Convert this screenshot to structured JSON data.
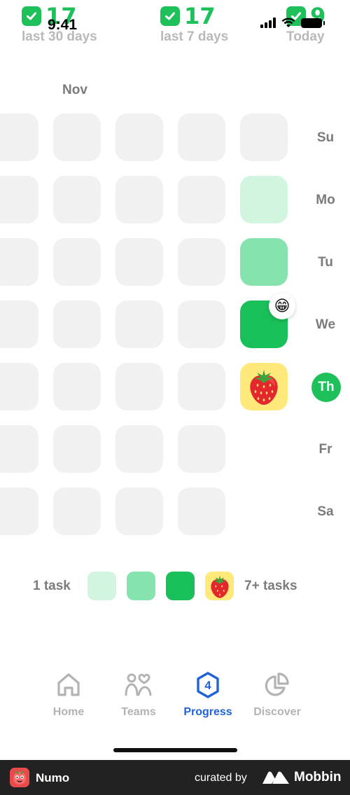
{
  "status_bar": {
    "time": "9:41"
  },
  "stats": [
    {
      "value": "17",
      "label": "last 30 days"
    },
    {
      "value": "17",
      "label": "last 7 days"
    },
    {
      "value": "9",
      "label": "Today"
    }
  ],
  "calendar": {
    "month": "Nov",
    "days": [
      "Su",
      "Mo",
      "Tu",
      "We",
      "Th",
      "Fr",
      "Sa"
    ],
    "today_index": 4,
    "emoji_badge": "😁",
    "current_week_levels": [
      0,
      1,
      2,
      3,
      4,
      null,
      null
    ]
  },
  "legend": {
    "min_label": "1 task",
    "max_label": "7+ tasks",
    "colors": [
      "#d2f5e0",
      "#86e3ae",
      "#19c05a",
      "#ffe97a"
    ]
  },
  "tabs": [
    {
      "label": "Home",
      "icon": "home-icon",
      "active": false
    },
    {
      "label": "Teams",
      "icon": "teams-icon",
      "active": false
    },
    {
      "label": "Progress",
      "icon": "progress-icon",
      "badge": "4",
      "active": true
    },
    {
      "label": "Discover",
      "icon": "discover-icon",
      "active": false
    }
  ],
  "footer": {
    "app_name": "Numo",
    "curated_by": "curated by",
    "brand": "Mobbin"
  },
  "colors": {
    "accent_green": "#1ec05a",
    "active_tab_blue": "#1f63d6",
    "inactive_gray": "#b3b3b3",
    "empty_cell": "#f1f1f1"
  }
}
